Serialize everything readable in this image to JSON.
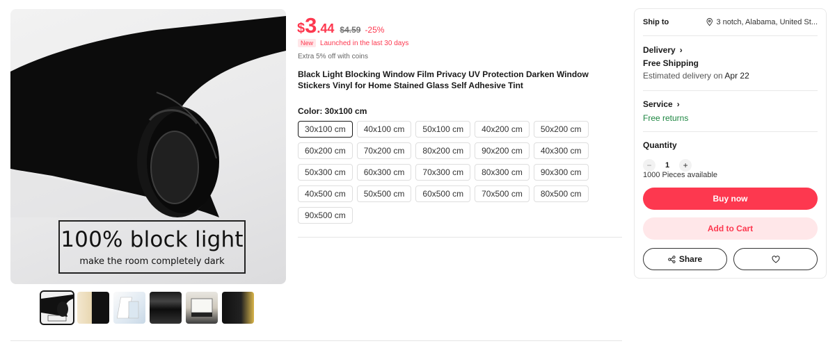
{
  "gallery": {
    "overlay_title": "100% block light",
    "overlay_subtitle": "make the room completely dark",
    "thumbnail_count": 6
  },
  "price": {
    "currency": "$",
    "integer": "3",
    "decimal": ".44",
    "original": "$4.59",
    "discount": "-25%"
  },
  "badge": {
    "label": "New",
    "text": "Launched in the last 30 days"
  },
  "coins_note": "Extra 5% off with coins",
  "product_title": "Black Light Blocking Window Film Privacy UV Protection Darken Window Stickers Vinyl for Home Stained Glass Self Adhesive Tint",
  "color": {
    "label": "Color:",
    "selected": "30x100 cm",
    "options": [
      "30x100 cm",
      "40x100 cm",
      "50x100 cm",
      "40x200 cm",
      "50x200 cm",
      "60x200 cm",
      "70x200 cm",
      "80x200 cm",
      "90x200 cm",
      "40x300 cm",
      "50x300 cm",
      "60x300 cm",
      "70x300 cm",
      "80x300 cm",
      "90x300 cm",
      "40x500 cm",
      "50x500 cm",
      "60x500 cm",
      "70x500 cm",
      "80x500 cm",
      "90x500 cm"
    ]
  },
  "panel": {
    "ship_to_label": "Ship to",
    "ship_to_value": "3 notch, Alabama, United St...",
    "delivery_label": "Delivery",
    "shipping": "Free Shipping",
    "estimated_prefix": "Estimated delivery on",
    "estimated_date": "Apr 22",
    "service_label": "Service",
    "service_value": "Free returns",
    "quantity_label": "Quantity",
    "quantity_value": "1",
    "availability": "1000 Pieces available",
    "buy_now": "Buy now",
    "add_to_cart": "Add to Cart",
    "share": "Share"
  },
  "colors": {
    "accent": "#fd384f",
    "accent_light": "#ffe7e9",
    "success": "#1d8641"
  }
}
